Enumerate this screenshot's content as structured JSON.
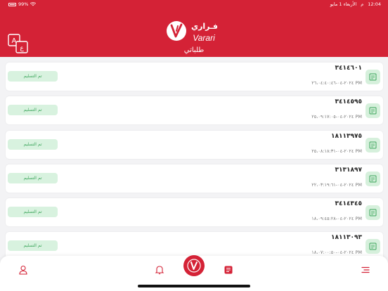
{
  "status_bar": {
    "battery": "99%",
    "time": "12:04",
    "date": "الأربعاء 1 مايو",
    "am_pm": "م"
  },
  "header": {
    "logo_arabic": "فـراري",
    "logo_latin": "Varari",
    "title": "طلباتي",
    "language_icon": "translate-icon"
  },
  "orders": [
    {
      "number": "٣٤١٤٦٠١",
      "date": "٢٠٢٤-٠٤-٢٦،٠٤:٤٠:٤٦ PM",
      "status": "تم التسليم"
    },
    {
      "number": "٣٤١٤٥٩٥",
      "date": "٢٠٢٤-٠٤-٢٥،٠٩:١٧:٠٥ PM",
      "status": "تم التسليم"
    },
    {
      "number": "١٨١١٣٩٧٥",
      "date": "٢٠٢٤-٠٤-٢٥،٠٨:١٨:٣١ PM",
      "status": "تم التسليم"
    },
    {
      "number": "٣١٣١٨٩٧",
      "date": "٢٠٢٤-٠٤-٢٢،٠٣:١٩:٦١ PM",
      "status": "تم التسليم"
    },
    {
      "number": "٣٤١٤٣٤٥",
      "date": "٢٠٢٤-٠٤-١٨،٠٩:٤٥:٢٨ PM",
      "status": "تم التسليم"
    },
    {
      "number": "١٨١١٣٠٩٣",
      "date": "٢٠٢٤-٠٤-١٨،٠٧:٠٠:٥٠ PM",
      "status": "تم التسليم"
    }
  ],
  "tab_bar": {
    "items": [
      "profile-icon",
      "bell-icon",
      "home-logo-icon",
      "orders-list-icon",
      "menu-icon"
    ],
    "active": "orders-list-icon",
    "accent": "#d42236"
  },
  "colors": {
    "brand_red": "#d42236",
    "delivered_bg": "#d8f2df",
    "delivered_text": "#3ba55a"
  }
}
